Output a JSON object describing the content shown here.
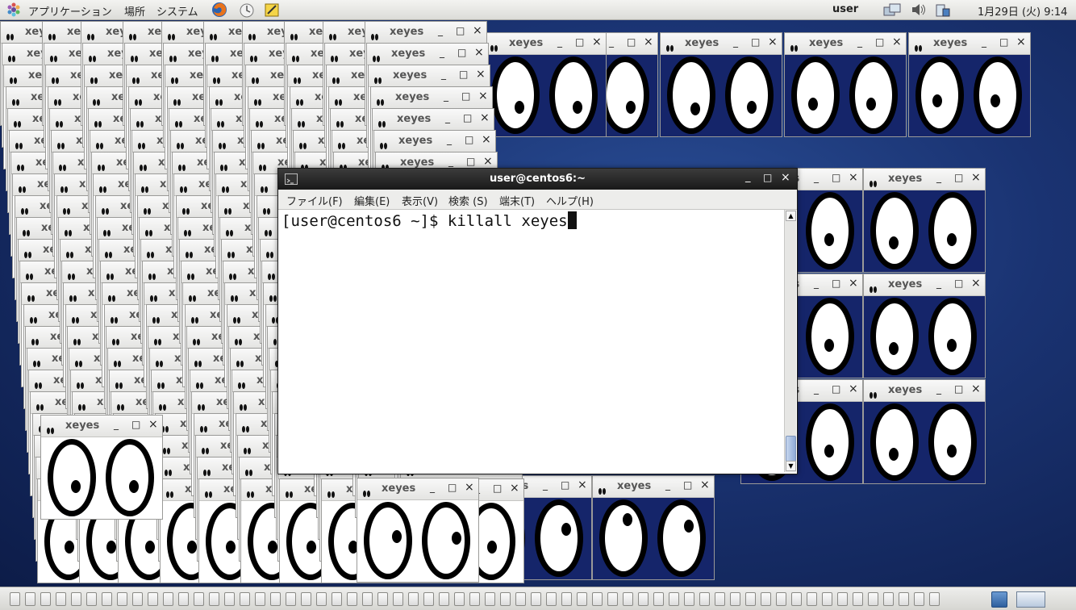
{
  "top_panel": {
    "menus": [
      "アプリケーション",
      "場所",
      "システム"
    ],
    "user": "user",
    "clock": "1月29日 (火)  9:14"
  },
  "xeyes": {
    "title": "xeyes",
    "minimize": "_",
    "maximize": "□",
    "close": "×"
  },
  "terminal": {
    "title": "user@centos6:~",
    "minimize": "_",
    "maximize": "□",
    "close": "×",
    "menu": [
      "ファイル(F)",
      "編集(E)",
      "表示(V)",
      "検索 (S)",
      "端末(T)",
      "ヘルプ(H)"
    ],
    "prompt": "[user@centos6 ~]$ ",
    "command": "killall xeyes"
  },
  "colors": {
    "desktop": "#1a3372",
    "eyes_background": "#15256a",
    "terminal_title": "#2a2a2a"
  }
}
